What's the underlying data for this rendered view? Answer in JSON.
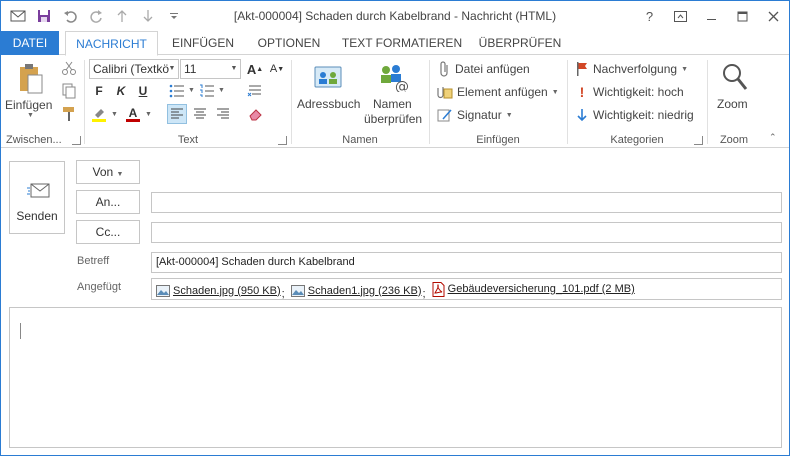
{
  "window": {
    "title": "[Akt-000004] Schaden durch Kabelbrand - Nachricht (HTML)",
    "help": "?",
    "accent": "#2b7cd3"
  },
  "tabs": [
    {
      "label": "DATEI"
    },
    {
      "label": "NACHRICHT"
    },
    {
      "label": "EINFÜGEN"
    },
    {
      "label": "OPTIONEN"
    },
    {
      "label": "TEXT FORMATIEREN"
    },
    {
      "label": "ÜBERPRÜFEN"
    }
  ],
  "ribbon": {
    "clipboard": {
      "paste": "Einfügen",
      "label": "Zwischen..."
    },
    "text": {
      "font": "Calibri (Textkö",
      "size": "11",
      "bold": "F",
      "italic": "K",
      "underline": "U",
      "label": "Text"
    },
    "names": {
      "addressbook": "Adressbuch",
      "check1": "Namen",
      "check2": "überprüfen",
      "label": "Namen"
    },
    "insert": {
      "attach_file": "Datei anfügen",
      "attach_item": "Element anfügen",
      "signature": "Signatur",
      "label": "Einfügen"
    },
    "tags": {
      "followup": "Nachverfolgung",
      "high": "Wichtigkeit: hoch",
      "low": "Wichtigkeit: niedrig",
      "label": "Kategorien"
    },
    "zoom": {
      "zoom": "Zoom",
      "label": "Zoom"
    }
  },
  "form": {
    "send": "Senden",
    "from": "Von",
    "to": "An...",
    "cc": "Cc...",
    "subject_label": "Betreff",
    "subject": "[Akt-000004] Schaden durch Kabelbrand",
    "attached_label": "Angefügt",
    "attachments": [
      {
        "name": "Schaden.jpg (950 KB)",
        "type": "image"
      },
      {
        "name": "Schaden1.jpg (236 KB)",
        "type": "image"
      },
      {
        "name": "Gebäudeversicherung_101.pdf (2 MB)",
        "type": "pdf"
      }
    ]
  }
}
